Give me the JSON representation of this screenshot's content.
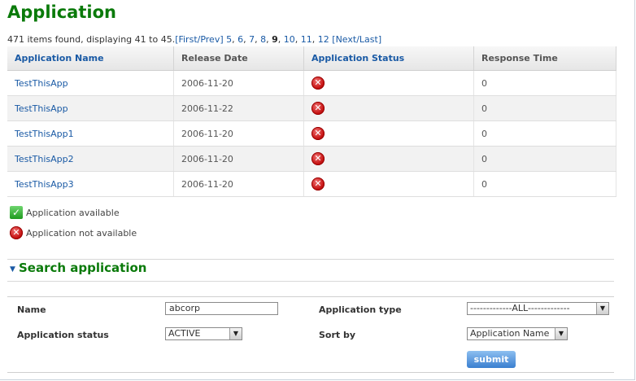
{
  "page": {
    "title": "Application"
  },
  "pager": {
    "summary": "471 items found, displaying 41 to 45.",
    "first_prev": "[First/Prev]",
    "pages": [
      "5",
      "6",
      "7",
      "8",
      "9",
      "10",
      "11",
      "12"
    ],
    "current": "9",
    "next_last": "[Next/Last]"
  },
  "table": {
    "headers": [
      "Application Name",
      "Release Date",
      "Application Status",
      "Response Time"
    ],
    "rows": [
      {
        "name": "TestThisApp",
        "release_date": "2006-11-20",
        "status": "not-available",
        "response_time": "0"
      },
      {
        "name": "TestThisApp",
        "release_date": "2006-11-22",
        "status": "not-available",
        "response_time": "0"
      },
      {
        "name": "TestThisApp1",
        "release_date": "2006-11-20",
        "status": "not-available",
        "response_time": "0"
      },
      {
        "name": "TestThisApp2",
        "release_date": "2006-11-20",
        "status": "not-available",
        "response_time": "0"
      },
      {
        "name": "TestThisApp3",
        "release_date": "2006-11-20",
        "status": "not-available",
        "response_time": "0"
      }
    ]
  },
  "legend": {
    "available": "Application available",
    "not_available": "Application not available"
  },
  "search": {
    "title": "Search application",
    "name_label": "Name",
    "name_value": "abcorp",
    "app_type_label": "Application type",
    "app_type_value": "-------------ALL-------------",
    "status_label": "Application status",
    "status_value": "ACTIVE",
    "sort_label": "Sort by",
    "sort_value": "Application Name",
    "submit_label": "submit"
  },
  "colors": {
    "title_green": "#0a7a0a",
    "link_blue": "#1a5aa5",
    "error_red": "#c71414"
  },
  "icons": {
    "status_not_available": "red-x-icon",
    "status_available": "green-check-icon",
    "section_toggle": "triangle-down-icon"
  }
}
